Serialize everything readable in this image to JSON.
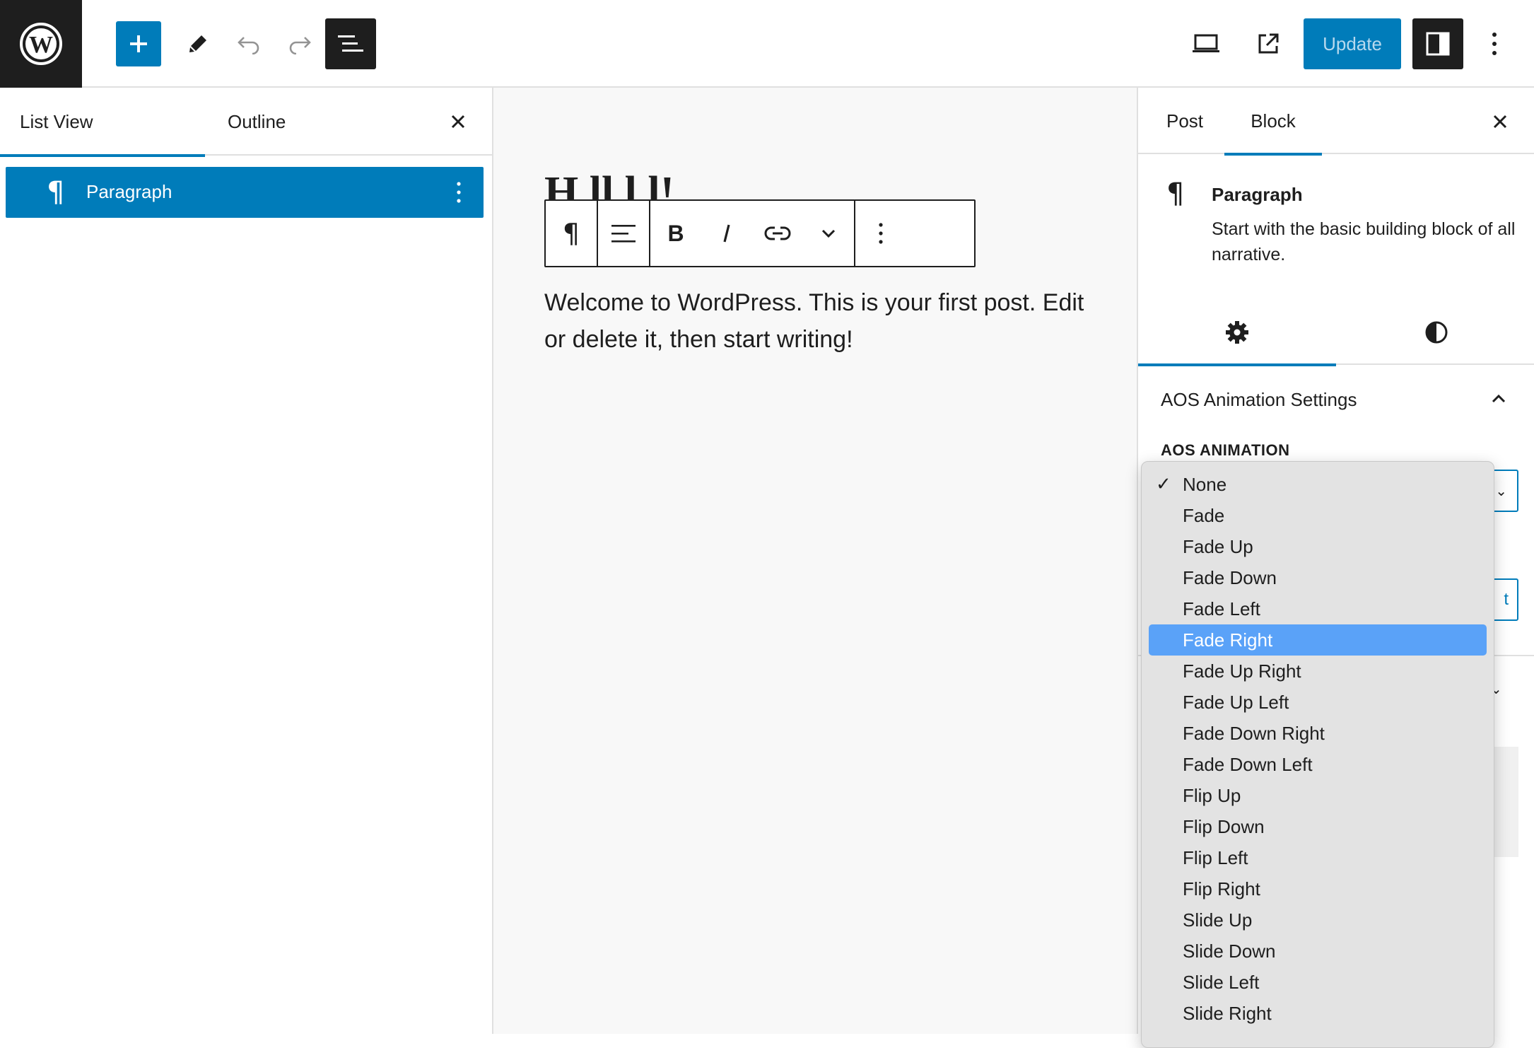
{
  "toolbar": {
    "update_label": "Update"
  },
  "left_panel": {
    "tabs": [
      "List View",
      "Outline"
    ],
    "rows": [
      {
        "icon": "¶",
        "label": "Paragraph"
      }
    ]
  },
  "canvas": {
    "title_partial": "H  ll        l  l!",
    "paragraph": "Welcome to WordPress. This is your first post. Edit or delete it, then start writing!"
  },
  "sidebar": {
    "tabs": [
      "Post",
      "Block"
    ],
    "block_card": {
      "icon": "¶",
      "title": "Paragraph",
      "description": "Start with the basic building block of all narrative."
    },
    "aos": {
      "panel_title": "AOS Animation Settings",
      "field_label": "AOS ANIMATION",
      "ghost_tail": "t"
    }
  },
  "dropdown": {
    "checked": "None",
    "highlighted": "Fade Right",
    "options": [
      "None",
      "Fade",
      "Fade Up",
      "Fade Down",
      "Fade Left",
      "Fade Right",
      "Fade Up Right",
      "Fade Up Left",
      "Fade Down Right",
      "Fade Down Left",
      "Flip Up",
      "Flip Down",
      "Flip Left",
      "Flip Right",
      "Slide Up",
      "Slide Down",
      "Slide Left",
      "Slide Right"
    ]
  },
  "colors": {
    "accent": "#007cba",
    "dark": "#1e1e1e",
    "highlight": "#5aa2f8"
  }
}
